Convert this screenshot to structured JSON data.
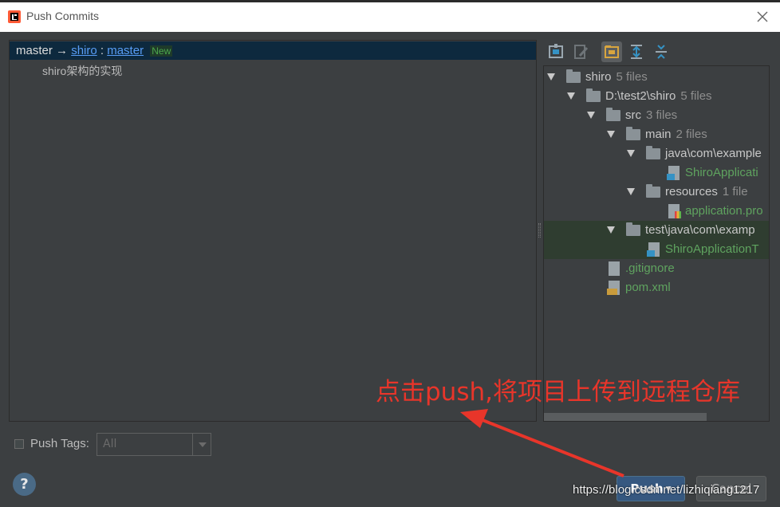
{
  "window": {
    "title": "Push Commits"
  },
  "commits": {
    "header": {
      "local_branch": "master",
      "arrow": "→",
      "remote": "shiro",
      "separator": ":",
      "remote_branch": "master",
      "badge": "New"
    },
    "items": [
      {
        "message": "shiro架构的实现"
      }
    ]
  },
  "tree": {
    "rows": [
      {
        "name": "shiro",
        "count": "5 files"
      },
      {
        "name": "D:\\test2\\shiro",
        "count": "5 files"
      },
      {
        "name": "src",
        "count": "3 files"
      },
      {
        "name": "main",
        "count": "2 files"
      },
      {
        "name": "java\\com\\example"
      },
      {
        "name": "ShiroApplicati"
      },
      {
        "name": "resources",
        "count": "1 file"
      },
      {
        "name": "application.pro"
      },
      {
        "name": "test\\java\\com\\examp"
      },
      {
        "name": "ShiroApplicationT"
      },
      {
        "name": ".gitignore"
      },
      {
        "name": "pom.xml"
      }
    ]
  },
  "footer": {
    "push_tags_label": "Push Tags:",
    "tags_select_value": "All",
    "help_label": "?",
    "push_label": "Push",
    "cancel_label": "Cancel"
  },
  "annotation": {
    "text": "点击push,将项目上传到远程仓库",
    "color": "#e8352a"
  },
  "watermark": "https://blog.csdn.net/lizhiqiang1217",
  "colors": {
    "accent": "#365880",
    "selection": "#0d293e",
    "link": "#589df6",
    "new_file": "#5fa35f"
  }
}
